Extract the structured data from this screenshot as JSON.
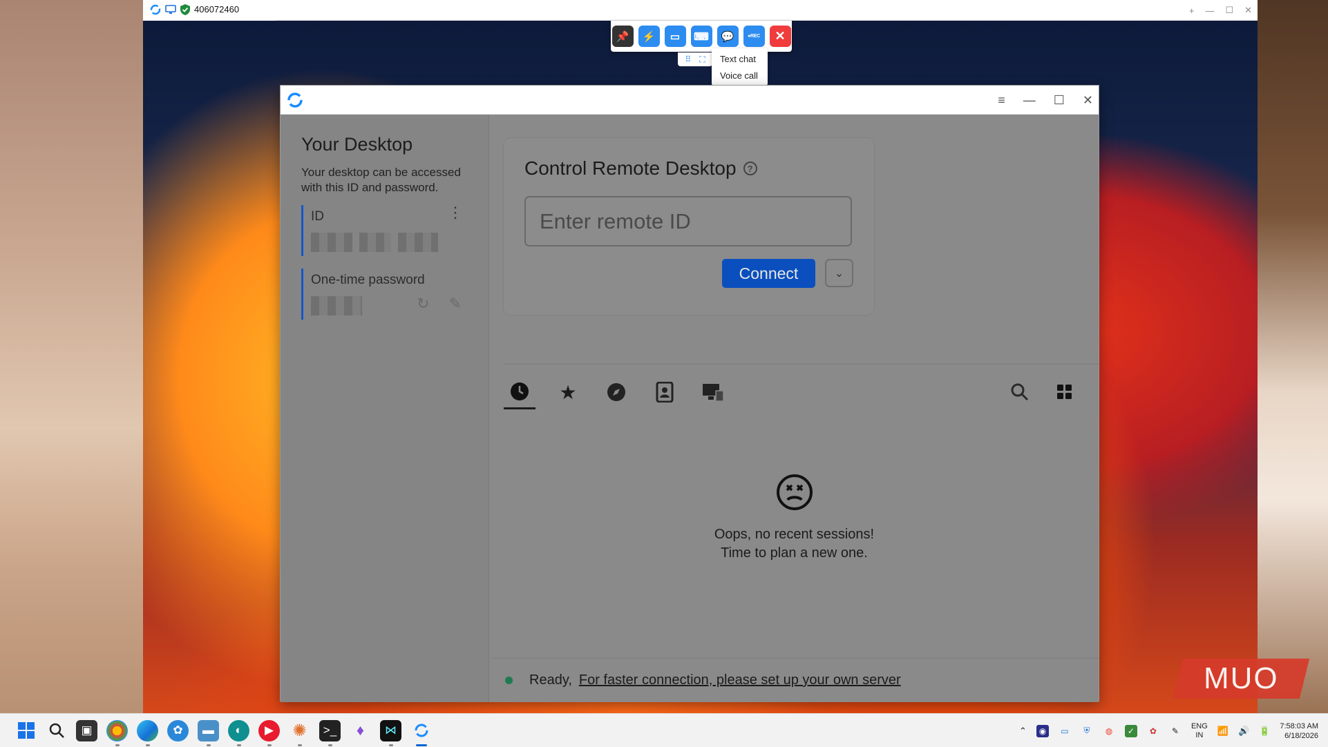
{
  "viewer": {
    "remote_id": "406072460",
    "controls": [
      "+",
      "—",
      "☐",
      "✕"
    ]
  },
  "toolbar": {
    "buttons": [
      {
        "icon": "pin-icon"
      },
      {
        "icon": "lightning-icon"
      },
      {
        "icon": "display-icon"
      },
      {
        "icon": "keyboard-icon"
      },
      {
        "icon": "chat-icon"
      },
      {
        "icon": "record-icon",
        "label": "●REC"
      },
      {
        "icon": "close-icon"
      }
    ],
    "chat_menu": [
      "Text chat",
      "Voice call"
    ]
  },
  "app": {
    "left": {
      "title": "Your Desktop",
      "description": "Your desktop can be accessed with this ID and password.",
      "id_label": "ID",
      "password_label": "One-time password"
    },
    "card": {
      "title": "Control Remote Desktop",
      "input_placeholder": "Enter remote ID",
      "connect_label": "Connect"
    },
    "tabs": [
      {
        "name": "recent-sessions",
        "icon": "clock-icon",
        "glyph": "🕓"
      },
      {
        "name": "favorites",
        "icon": "star-icon",
        "glyph": "★"
      },
      {
        "name": "discovered",
        "icon": "compass-icon",
        "glyph": "🧭"
      },
      {
        "name": "address-book",
        "icon": "contact-book-icon",
        "glyph": "👤"
      },
      {
        "name": "accessible-devices",
        "icon": "devices-icon",
        "glyph": "🖥"
      }
    ],
    "empty_state": {
      "line1": "Oops, no recent sessions!",
      "line2": "Time to plan a new one."
    },
    "status": {
      "ready": "Ready,",
      "link": "For faster connection, please set up your own server"
    }
  },
  "watermark": "MUO",
  "taskbar": {
    "lang_top": "ENG",
    "lang_bottom": "IN",
    "time": "7:58:03 AM",
    "date": "6/18/2026"
  },
  "colors": {
    "accent": "#0a4fbd",
    "status_ok": "#1f7a4f",
    "toolbar_blue": "#2d8cf0",
    "toolbar_close": "#f03c3c"
  }
}
